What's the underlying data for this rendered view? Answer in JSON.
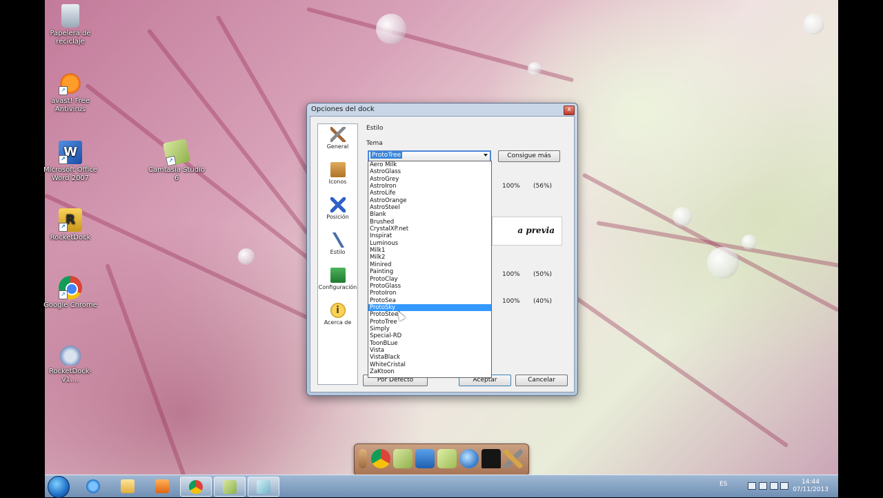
{
  "desktop": {
    "icons": [
      {
        "label": "Papelera de reciclaje",
        "icon": "recycle-bin-icon"
      },
      {
        "label": "avast! Free Antivirus",
        "icon": "avast-icon"
      },
      {
        "label": "Microsoft Office Word 2007",
        "icon": "word-icon"
      },
      {
        "label": "Camtasia Studio 6",
        "icon": "camtasia-icon"
      },
      {
        "label": "RocketDock",
        "icon": "rocketdock-icon"
      },
      {
        "label": "Google Chrome",
        "icon": "chrome-icon"
      },
      {
        "label": "RocketDock-v1....",
        "icon": "installer-icon"
      }
    ]
  },
  "dialog": {
    "title": "Opciones del dock",
    "close_label": "x",
    "nav": [
      {
        "label": "General",
        "icon": "tools-icon"
      },
      {
        "label": "Iconos",
        "icon": "box-icon"
      },
      {
        "label": "Posición",
        "icon": "position-icon"
      },
      {
        "label": "Estilo",
        "icon": "brush-icon"
      },
      {
        "label": "Configuración",
        "icon": "config-icon"
      },
      {
        "label": "Acerca de",
        "icon": "info-icon"
      }
    ],
    "section_title": "Estilo",
    "theme_label": "Tema",
    "theme_selected": "ProtoTree",
    "get_more_button": "Consigue más",
    "values": [
      {
        "value": "100%",
        "extra": "(56%)"
      },
      {
        "value": "100%",
        "extra": "(50%)"
      },
      {
        "value": "100%",
        "extra": "(40%)"
      }
    ],
    "preview_text": "a previa",
    "buttons": {
      "default": "Por Defecto",
      "accept": "Aceptar",
      "cancel": "Cancelar"
    },
    "theme_options": [
      "Aero Milk",
      "AstroGlass",
      "AstroGrey",
      "AstroIron",
      "AstroLife",
      "AstroOrange",
      "AstroSteel",
      "Blank",
      "Brushed",
      "CrystalXP.net",
      "Inspirat",
      "Luminous",
      "Milk1",
      "Milk2",
      "Minired",
      "Painting",
      "ProtoClay",
      "ProtoGlass",
      "ProtoIron",
      "ProtoSea",
      "ProtoSky",
      "ProtoSteel",
      "ProtoTree",
      "Simply",
      "Special-RD",
      "ToonBLue",
      "Vista",
      "VistaBlack",
      "WhiteCristal",
      "ZaKtoon"
    ],
    "highlighted_option": "ProtoSky"
  },
  "taskbar": {
    "language": "ES",
    "time": "14:44",
    "date": "07/11/2013"
  },
  "colors": {
    "highlight": "#3399ff",
    "dialog_frame": "#b7c8de",
    "taskbar": "#6f8fb4"
  }
}
